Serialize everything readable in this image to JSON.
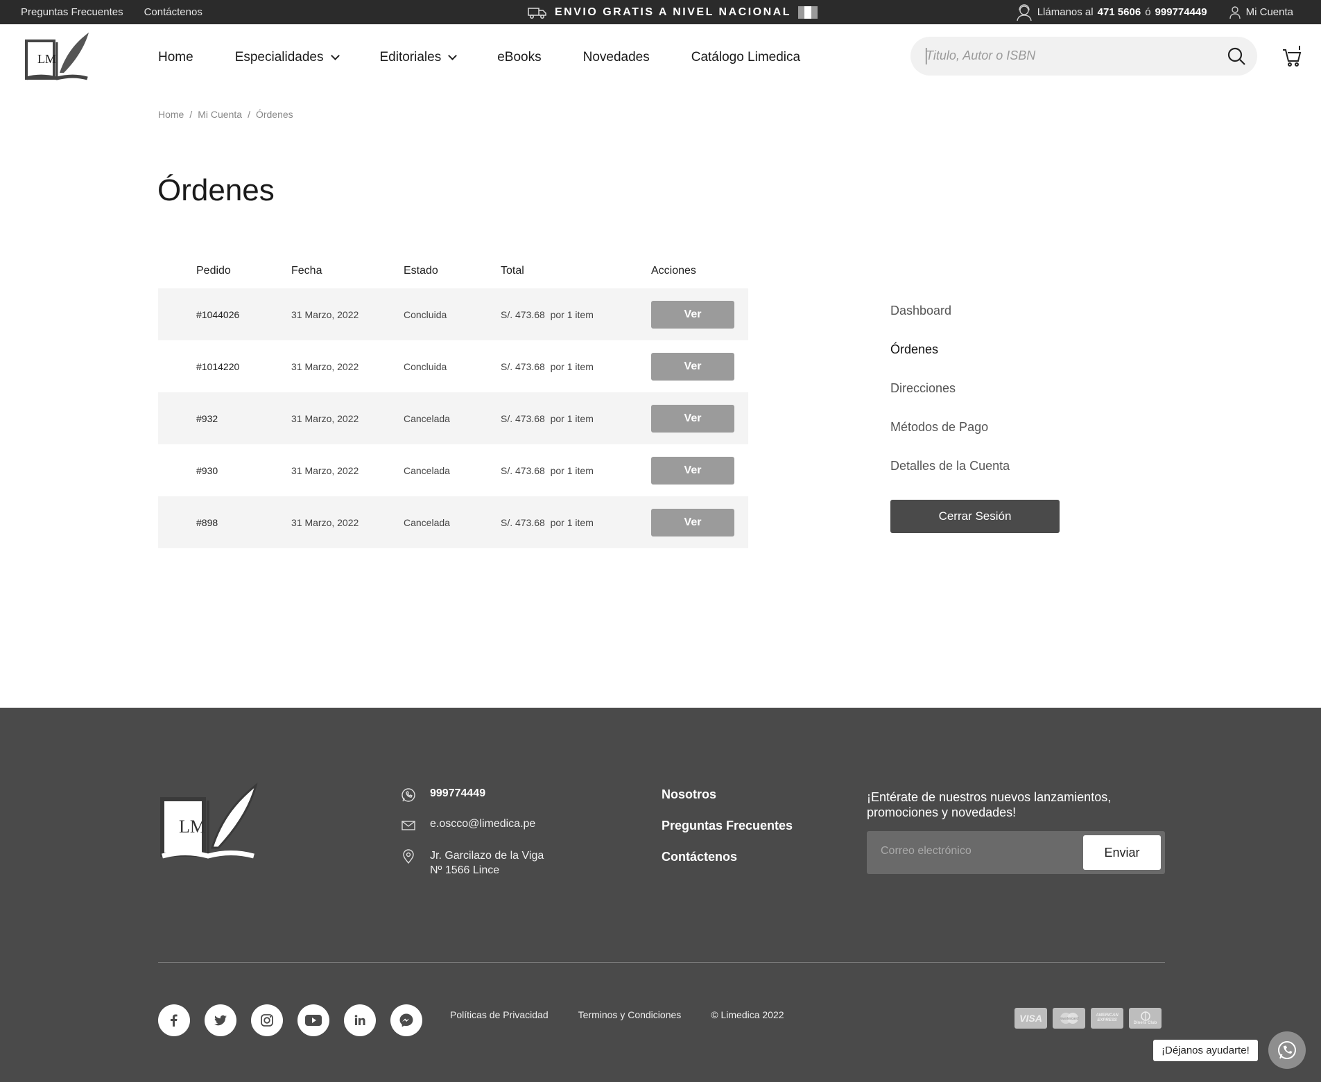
{
  "topbar": {
    "faq": "Preguntas Frecuentes",
    "contact": "Contáctenos",
    "shipping": "ENVIO GRATIS A NIVEL NACIONAL",
    "call_prefix": "Llámanos al",
    "phone1": "471 5606",
    "or": "ó",
    "phone2": "999774449",
    "account": "Mi Cuenta"
  },
  "nav": {
    "items": [
      {
        "label": "Home"
      },
      {
        "label": "Especialidades"
      },
      {
        "label": "Editoriales"
      },
      {
        "label": "eBooks"
      },
      {
        "label": "Novedades"
      },
      {
        "label": "Catálogo Limedica"
      }
    ]
  },
  "search": {
    "placeholder": "Titulo, Autor o ISBN"
  },
  "breadcrumb": [
    "Home",
    "/",
    "Mi Cuenta",
    "/",
    "Órdenes"
  ],
  "page_title": "Órdenes",
  "orders": {
    "headers": [
      "Pedido",
      "Fecha",
      "Estado",
      "Total",
      "Acciones"
    ],
    "rows": [
      {
        "id": "#1044026",
        "date": "31 Marzo, 2022",
        "status": "Concluida",
        "total": "S/. 473.68",
        "qty": "por 1 item",
        "action": "Ver"
      },
      {
        "id": "#1014220",
        "date": "31 Marzo, 2022",
        "status": "Concluida",
        "total": "S/. 473.68",
        "qty": "por 1 item",
        "action": "Ver"
      },
      {
        "id": "#932",
        "date": "31 Marzo, 2022",
        "status": "Cancelada",
        "total": "S/. 473.68",
        "qty": "por 1 item",
        "action": "Ver"
      },
      {
        "id": "#930",
        "date": "31 Marzo, 2022",
        "status": "Cancelada",
        "total": "S/. 473.68",
        "qty": "por 1 item",
        "action": "Ver"
      },
      {
        "id": "#898",
        "date": "31 Marzo, 2022",
        "status": "Cancelada",
        "total": "S/. 473.68",
        "qty": "por 1 item",
        "action": "Ver"
      }
    ]
  },
  "account_nav": {
    "items": [
      "Dashboard",
      "Órdenes",
      "Direcciones",
      "Métodos de Pago",
      "Detalles de la Cuenta"
    ],
    "active": "Órdenes",
    "logout": "Cerrar Sesión"
  },
  "footer": {
    "phone": "999774449",
    "email": "e.oscco@limedica.pe",
    "address_line1": "Jr. Garcilazo de la Viga",
    "address_line2": "Nº 1566 Lince",
    "links": [
      "Nosotros",
      "Preguntas Frecuentes",
      "Contáctenos"
    ],
    "newsletter_text": "¡Entérate de nuestros nuevos lanzamientos, promociones y novedades!",
    "email_placeholder": "Correo electrónico",
    "send": "Enviar",
    "legal": [
      "Políticas de Privacidad",
      "Terminos y Condiciones",
      "© Limedica 2022"
    ],
    "socials": [
      "facebook-icon",
      "twitter-icon",
      "instagram-icon",
      "youtube-icon",
      "linkedin-icon",
      "messenger-icon"
    ],
    "cards": [
      "VISA",
      "mastercard",
      "AMERICAN EXPRESS",
      "Diners Club"
    ]
  },
  "chat": {
    "label": "¡Déjanos ayudarte!"
  },
  "logo_text": "LM",
  "colors": {
    "topbar": "#2b2b2b",
    "footer": "#4a4a4a",
    "button": "#9b9b9b",
    "logout": "#4a4a4a"
  }
}
